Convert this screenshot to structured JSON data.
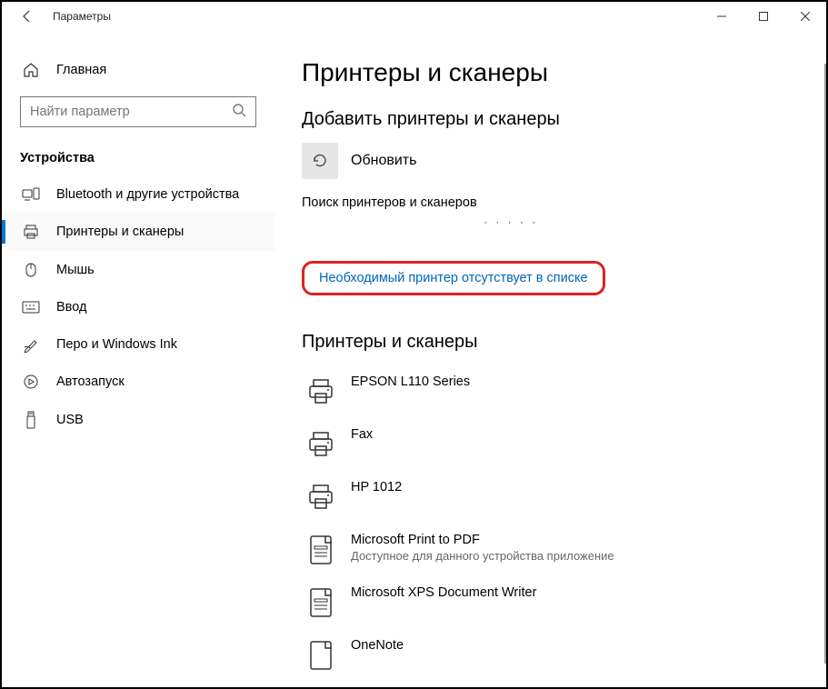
{
  "window": {
    "title": "Параметры"
  },
  "sidebar": {
    "home": "Главная",
    "search_placeholder": "Найти параметр",
    "category": "Устройства",
    "items": [
      {
        "label": "Bluetooth и другие устройства"
      },
      {
        "label": "Принтеры и сканеры"
      },
      {
        "label": "Мышь"
      },
      {
        "label": "Ввод"
      },
      {
        "label": "Перо и Windows Ink"
      },
      {
        "label": "Автозапуск"
      },
      {
        "label": "USB"
      }
    ]
  },
  "main": {
    "title": "Принтеры и сканеры",
    "add_section": "Добавить принтеры и сканеры",
    "refresh": "Обновить",
    "searching": "Поиск принтеров и сканеров",
    "dots": "·   · · · ·",
    "not_in_list": "Необходимый принтер отсутствует в списке",
    "list_section": "Принтеры и сканеры",
    "devices": [
      {
        "label": "EPSON L110 Series",
        "sub": ""
      },
      {
        "label": "Fax",
        "sub": ""
      },
      {
        "label": "HP 1012",
        "sub": ""
      },
      {
        "label": "Microsoft Print to PDF",
        "sub": "Доступное для данного устройства приложение"
      },
      {
        "label": "Microsoft XPS Document Writer",
        "sub": ""
      },
      {
        "label": "OneNote",
        "sub": ""
      }
    ]
  }
}
